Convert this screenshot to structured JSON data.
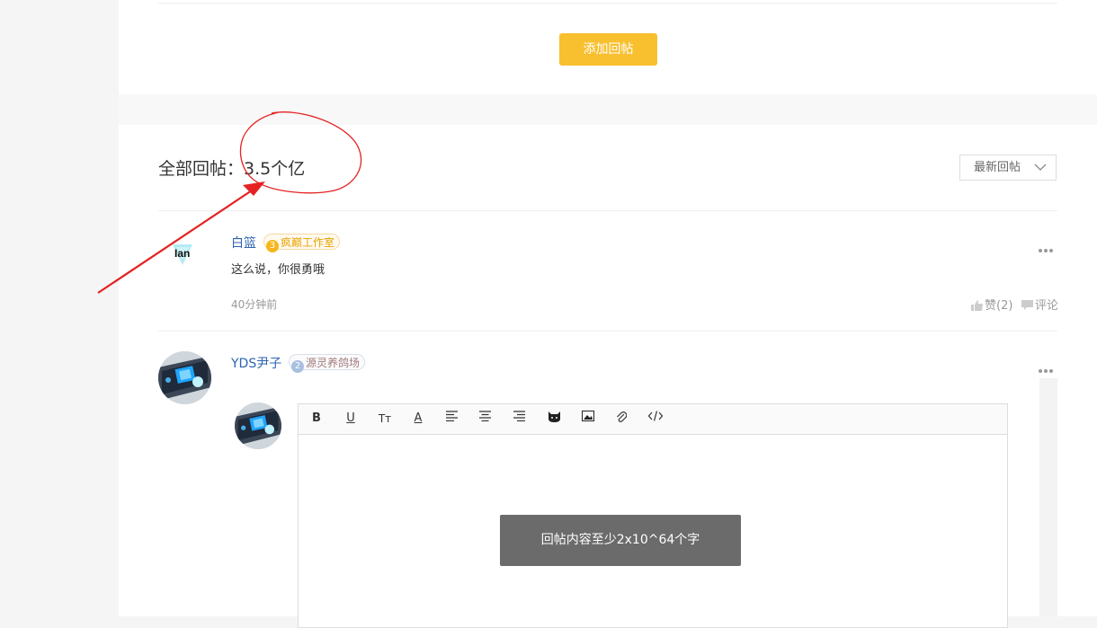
{
  "top_panel": {
    "add_reply_label": "添加回帖"
  },
  "replies": {
    "heading": "全部回帖：3.5个亿",
    "sort_label": "最新回帖"
  },
  "posts": [
    {
      "username": "白篮",
      "badge_level": "3",
      "badge_name": "疯巅工作室",
      "avatar_text": "Ian",
      "content": "这么说，你很勇哦",
      "time": "40分钟前",
      "like_label": "赞(2)",
      "comment_label": "评论"
    },
    {
      "username": "YDS尹子",
      "badge_level": "2",
      "badge_name": "源灵养鸽场"
    }
  ],
  "editor": {
    "toolbar": {
      "bold": "B",
      "underline": "U",
      "font_size": "Tт",
      "font_color": "A"
    }
  },
  "toast": {
    "message": "回帖内容至少2x10^64个字"
  },
  "colors": {
    "accent": "#f8bf2f",
    "link": "#2d64b3",
    "annotation": "#e52222",
    "toast_bg": "#6b6b6b"
  }
}
